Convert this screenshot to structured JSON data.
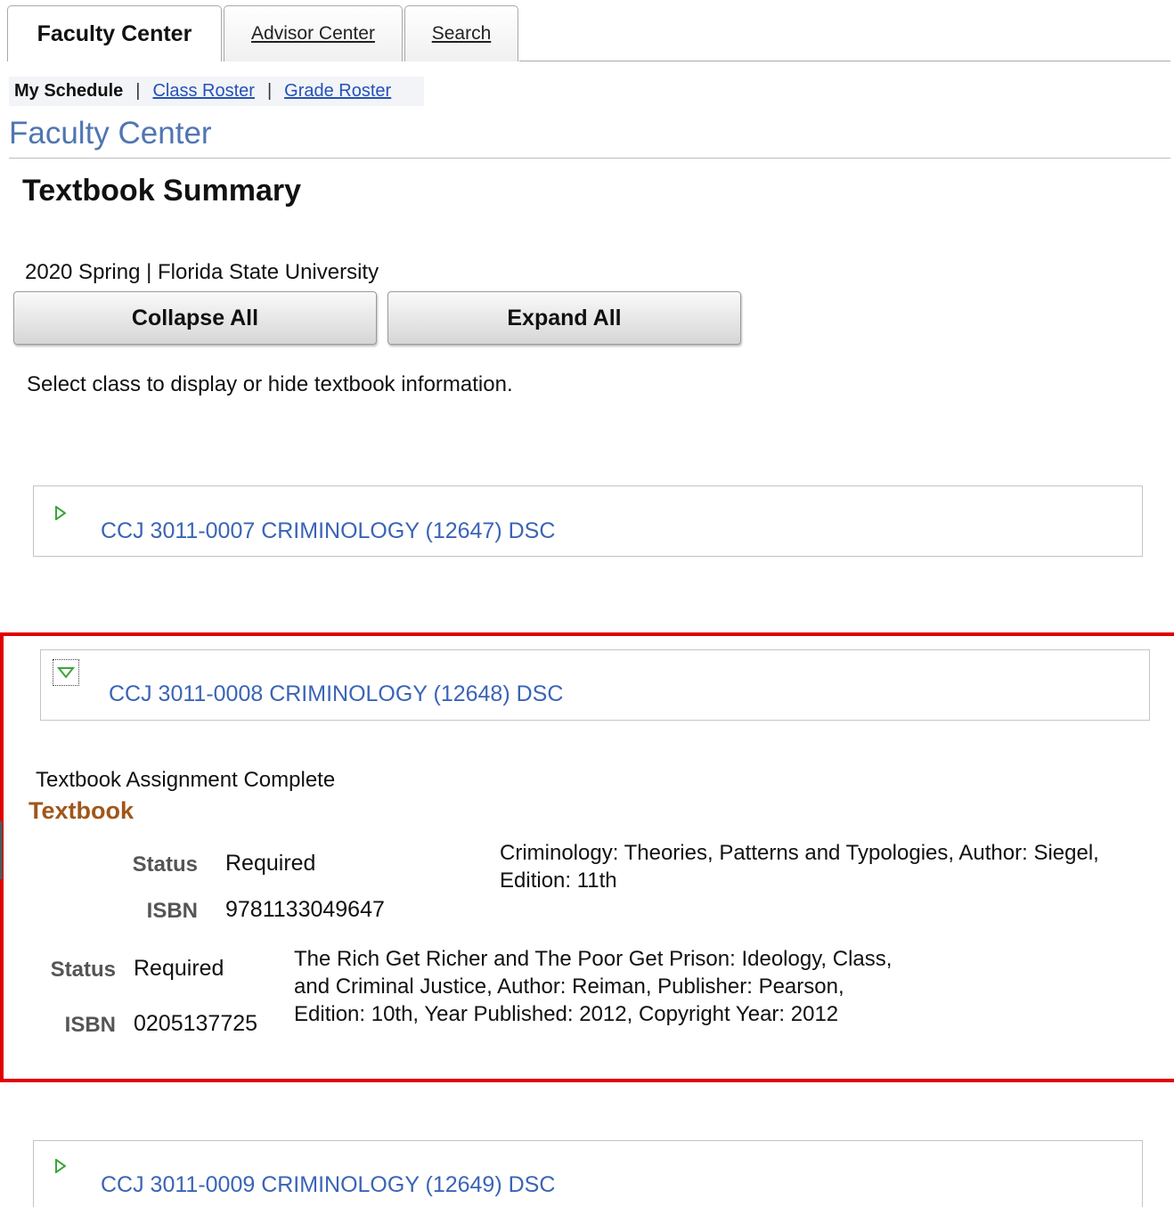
{
  "tabs": [
    {
      "label": "Faculty Center",
      "active": true
    },
    {
      "label": "Advisor Center",
      "active": false
    },
    {
      "label": "Search",
      "active": false
    }
  ],
  "subnav": {
    "current": "My Schedule",
    "separator": "|",
    "links": [
      "Class Roster",
      "Grade Roster"
    ]
  },
  "page_title": "Faculty Center",
  "summary_title": "Textbook Summary",
  "term": "2020 Spring | Florida State University",
  "buttons": {
    "collapse": "Collapse All",
    "expand": "Expand All"
  },
  "instruction": "Select class to display or hide textbook information.",
  "classes": [
    {
      "title": "CCJ 3011-0007 CRIMINOLOGY (12647) DSC",
      "expanded": false
    },
    {
      "title": "CCJ 3011-0008 CRIMINOLOGY (12648) DSC",
      "expanded": true,
      "assignment_status": "Textbook Assignment Complete",
      "section_heading": "Textbook",
      "books": [
        {
          "status_label": "Status",
          "status": "Required",
          "isbn_label": "ISBN",
          "isbn": "9781133049647",
          "description": "Criminology: Theories, Patterns and Typologies, Author: Siegel, Edition: 11th"
        },
        {
          "status_label": "Status",
          "status": "Required",
          "isbn_label": "ISBN",
          "isbn": "0205137725",
          "description": "The Rich Get Richer and The Poor Get Prison: Ideology, Class, and Criminal Justice, Author: Reiman, Publisher: Pearson, Edition: 10th, Year Published: 2012, Copyright Year: 2012"
        }
      ]
    },
    {
      "title": "CCJ 3011-0009 CRIMINOLOGY (12649) DSC",
      "expanded": false
    }
  ],
  "colors": {
    "link": "#3a64b6",
    "title_blue": "#4f76b2",
    "textbook_heading": "#a0561a",
    "highlight_border": "#e00000",
    "expand_arrow": "#3aa63a"
  }
}
